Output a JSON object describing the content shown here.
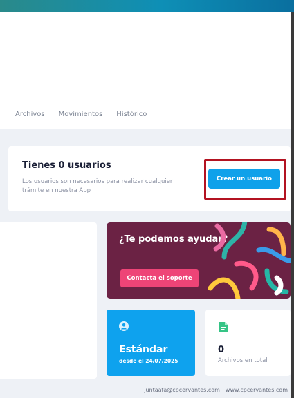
{
  "tabs": [
    "Archivos",
    "Movimientos",
    "Histórico"
  ],
  "users": {
    "title": "Tienes 0 usuarios",
    "description": "Los usuarios son necesarios para realizar cualquier trámite en nuestra App",
    "create_label": "Crear un usuario"
  },
  "help": {
    "title": "¿Te podemos ayudar?",
    "support_label": "Contacta el soporte"
  },
  "plan": {
    "icon": "user-circle-icon",
    "name": "Estándar",
    "since": "desde el 24/07/2025"
  },
  "files": {
    "icon": "document-icon",
    "count": "0",
    "label": "Archivos en total"
  },
  "footer": {
    "email": "juntaafa@cpcervantes.com",
    "website": "www.cpcervantes.com"
  },
  "colors": {
    "accent": "#0fa1ea",
    "help_bg": "#6b2244",
    "support_button": "#ee4477",
    "highlight": "#b31321"
  }
}
